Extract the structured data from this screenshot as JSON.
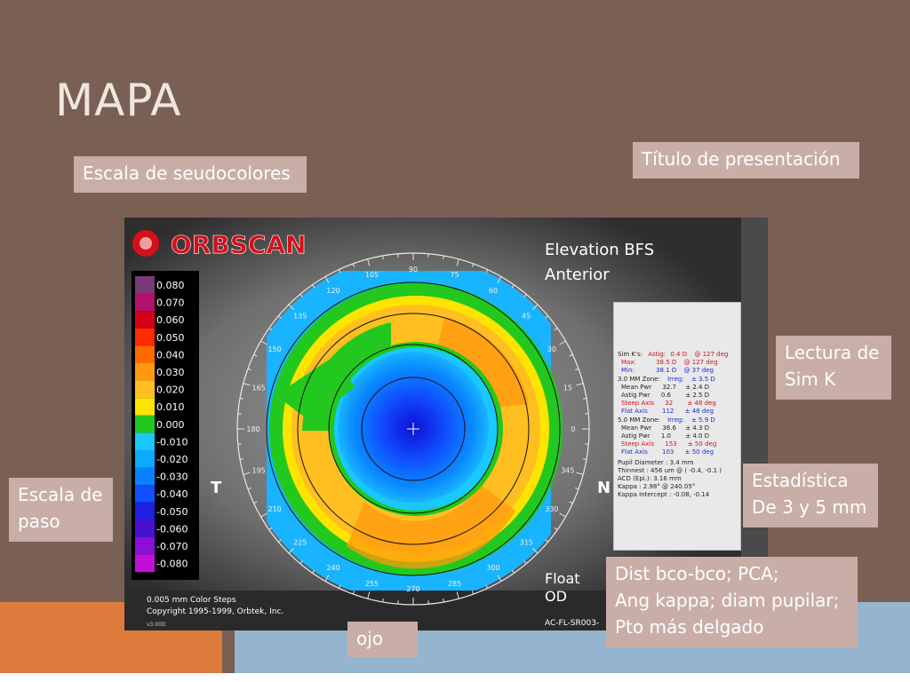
{
  "slide": {
    "title": "MAPA"
  },
  "callouts": {
    "escala_seudocolores": "Escala de seudocolores",
    "titulo_presentacion": "Título de presentación",
    "lectura_sim_k_1": "Lectura de",
    "lectura_sim_k_2": "Sim K",
    "estadistica_1": "Estadística",
    "estadistica_2": "De 3 y 5 mm",
    "escala_paso_1": "Escala de",
    "escala_paso_2": "paso",
    "dist_1": "Dist bco-bco; PCA;",
    "dist_2": "Ang kappa; diam pupilar;",
    "dist_3": "Pto más delgado",
    "ojo": "ojo"
  },
  "orbscan": {
    "logo": "ORBSCAN",
    "map_title_1": "Elevation BFS",
    "map_title_2": "Anterior",
    "scale_values": [
      "0.080",
      "0.070",
      "0.060",
      "0.050",
      "0.040",
      "0.030",
      "0.020",
      "0.010",
      "0.000",
      "-0.010",
      "-0.020",
      "-0.030",
      "-0.040",
      "-0.050",
      "-0.060",
      "-0.070",
      "-0.080"
    ],
    "scale_colors": [
      "#7a3a78",
      "#b4106e",
      "#d40018",
      "#ff2a00",
      "#ff6a00",
      "#ff9a10",
      "#ffbf20",
      "#ffe400",
      "#22c81e",
      "#19c8ff",
      "#0fa8ff",
      "#0a80ff",
      "#1050ff",
      "#2020e0",
      "#4a10d0",
      "#8a10d8",
      "#c010d8"
    ],
    "step_text": "0.005 mm Color Steps",
    "copyright": "Copyright 1995-1999, Orbtek, Inc.",
    "version": "v3.00D",
    "side_t": "T",
    "side_n": "N",
    "float_1": "Float",
    "float_2": "OD",
    "file_code": "AC-FL-SR003-",
    "angles": [
      "90",
      "105",
      "120",
      "135",
      "150",
      "165",
      "180",
      "195",
      "210",
      "225",
      "240",
      "255",
      "270",
      "285",
      "300",
      "315",
      "330",
      "345",
      "0",
      "15",
      "30",
      "45",
      "60",
      "75"
    ]
  },
  "stats_panel": {
    "simk_label": "Sim K's:",
    "astig_label": "Astig:",
    "astig_val": "0.4 D",
    "astig_axis": "@ 127 deg",
    "max_label": "Max:",
    "max_val": "38.5 D",
    "max_axis": "@ 127 deg",
    "min_label": "Min:",
    "min_val": "38.1 D",
    "min_axis": "@ 37 deg",
    "zone3": "3.0 MM Zone:",
    "zone3_irreg_label": "Irreg:",
    "zone3_irreg": "± 3.5 D",
    "zone3_mean_label": "Mean Pwr",
    "zone3_mean": "32.7",
    "zone3_mean_pm": "± 2.4 D",
    "zone3_astig_label": "Astig Pwr",
    "zone3_astig": "0.6",
    "zone3_astig_pm": "± 2.5 D",
    "zone3_steep_label": "Steep Axis",
    "zone3_steep": "32",
    "zone3_steep_pm": "± 48 deg",
    "zone3_flat_label": "Flat Axis",
    "zone3_flat": "112",
    "zone3_flat_pm": "± 48 deg",
    "zone5": "5.0 MM Zone:",
    "zone5_irreg_label": "Irreg:",
    "zone5_irreg": "± 5.9 D",
    "zone5_mean_label": "Mean Pwr",
    "zone5_mean": "36.6",
    "zone5_mean_pm": "± 4.3 D",
    "zone5_astig_label": "Astig Pwr",
    "zone5_astig": "1.0",
    "zone5_astig_pm": "± 4.0 D",
    "zone5_steep_label": "Steep Axis",
    "zone5_steep": "153",
    "zone5_steep_pm": "± 50 deg",
    "zone5_flat_label": "Flat Axis",
    "zone5_flat": "103",
    "zone5_flat_pm": "± 50 deg",
    "pupil": "Pupil Diameter : 3.4 mm",
    "thinnest": "Thinnest : 456 um @ ( -0.4, -0.1 )",
    "acd": "ACD (Epi.): 3.16 mm",
    "kappa": "Kappa : 2.98° @ 240.05°",
    "kappa_intercept": "Kappa Intercept : -0.08, -0.14"
  },
  "colors": {
    "slide_bg": "#7a5f54",
    "callout_bg": "#c9aea7",
    "orange_bar": "#df7a3d",
    "blue_bar": "#95b5cf"
  }
}
